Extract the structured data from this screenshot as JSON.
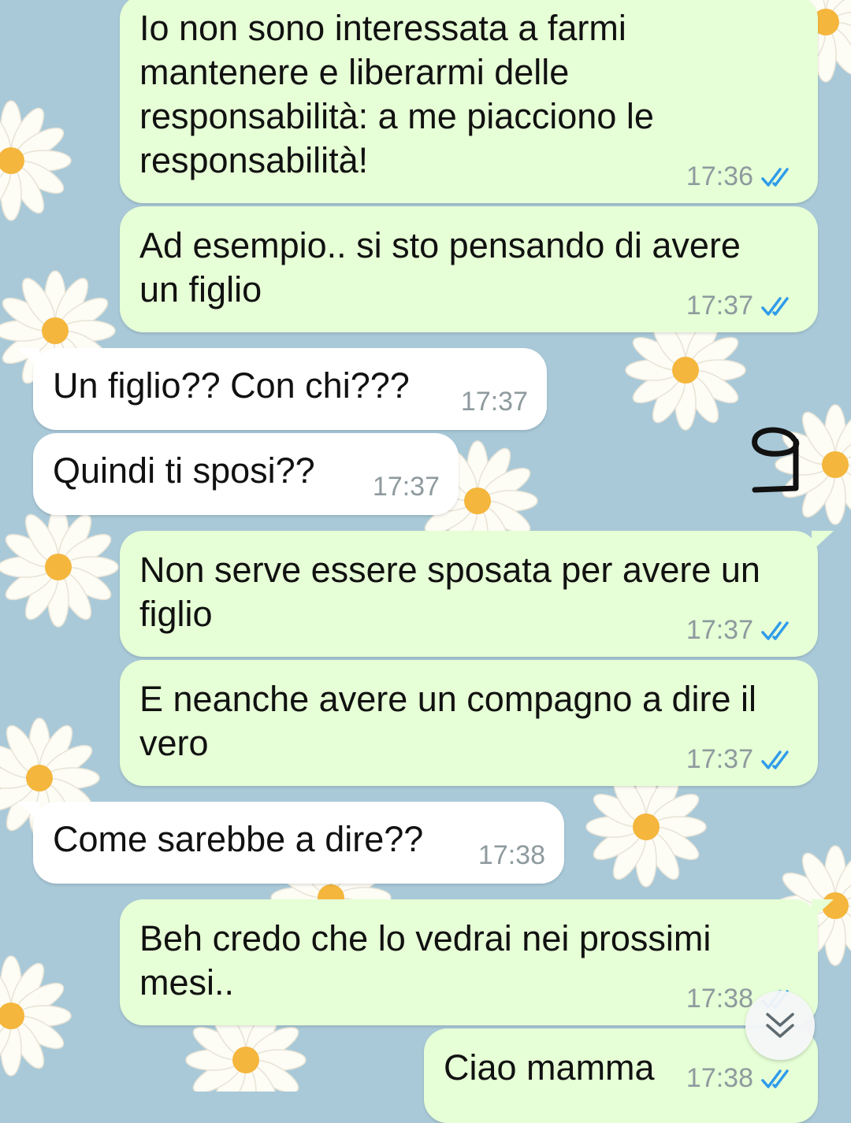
{
  "messages": [
    {
      "direction": "outgoing",
      "text": "Io non sono interessata a farmi\nmantenere e liberarmi delle\nresponsabilità: a me piacciono le\nresponsabilità!",
      "time": "17:36",
      "status": "read"
    },
    {
      "direction": "outgoing",
      "text": "Ad esempio.. si sto pensando di avere\nun figlio",
      "time": "17:37",
      "status": "read"
    },
    {
      "direction": "incoming",
      "text": "Un figlio?? Con chi???",
      "time": "17:37"
    },
    {
      "direction": "incoming",
      "text": "Quindi ti sposi??",
      "time": "17:37"
    },
    {
      "direction": "outgoing",
      "text": "Non serve essere sposata per avere un\nfiglio",
      "time": "17:37",
      "status": "read"
    },
    {
      "direction": "outgoing",
      "text": "E neanche avere un compagno a dire il\nvero",
      "time": "17:37",
      "status": "read"
    },
    {
      "direction": "incoming",
      "text": "Come sarebbe a dire??",
      "time": "17:38"
    },
    {
      "direction": "outgoing",
      "text": "Beh credo che lo vedrai nei prossimi\nmesi..",
      "time": "17:38",
      "status": "read"
    },
    {
      "direction": "outgoing",
      "text": "Ciao mamma",
      "time": "17:38",
      "status": "read"
    }
  ],
  "annotation": {
    "text": "9"
  },
  "colors": {
    "outgoing_bubble": "#e6ffd6",
    "incoming_bubble": "#ffffff",
    "read_ticks": "#2f9bea",
    "wallpaper_bg": "#a9c9d8",
    "petal": "#fdfcf5",
    "flower_center": "#f4b63c"
  },
  "icons": {
    "read_status": "double-check-icon",
    "scroll_down": "chevron-down-double-icon"
  }
}
